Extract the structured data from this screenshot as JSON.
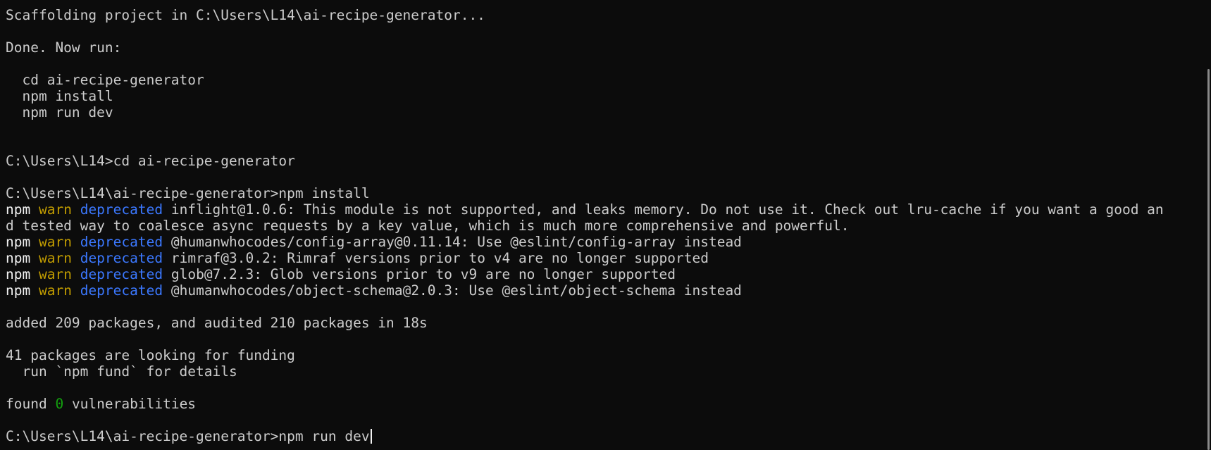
{
  "terminal": {
    "scaffold_line": "Scaffolding project in C:\\Users\\L14\\ai-recipe-generator...",
    "done_line": "Done. Now run:",
    "instructions": [
      "  cd ai-recipe-generator",
      "  npm install",
      "  npm run dev"
    ],
    "prompt_cd": "C:\\Users\\L14>cd ai-recipe-generator",
    "prompt_install": "C:\\Users\\L14\\ai-recipe-generator>npm install",
    "warn_prefix": {
      "npm": "npm",
      "warn": "warn",
      "deprecated": "deprecated"
    },
    "warnings": [
      "inflight@1.0.6: This module is not supported, and leaks memory. Do not use it. Check out lru-cache if you want a good an",
      "@humanwhocodes/config-array@0.11.14: Use @eslint/config-array instead",
      "rimraf@3.0.2: Rimraf versions prior to v4 are no longer supported",
      "glob@7.2.3: Glob versions prior to v9 are no longer supported",
      "@humanwhocodes/object-schema@2.0.3: Use @eslint/object-schema instead"
    ],
    "inflight_continuation": "d tested way to coalesce async requests by a key value, which is much more comprehensive and powerful.",
    "added_line": "added 209 packages, and audited 210 packages in 18s",
    "funding_line": "41 packages are looking for funding",
    "fund_hint": "  run `npm fund` for details",
    "found_prefix": "found ",
    "vuln_count": "0",
    "found_suffix": " vulnerabilities",
    "prompt_dev": "C:\\Users\\L14\\ai-recipe-generator>npm run dev"
  },
  "colors": {
    "background": "#0c0c0c",
    "text": "#cccccc",
    "warn": "#c19c00",
    "deprecated": "#3b78ff",
    "success": "#13a10e"
  }
}
